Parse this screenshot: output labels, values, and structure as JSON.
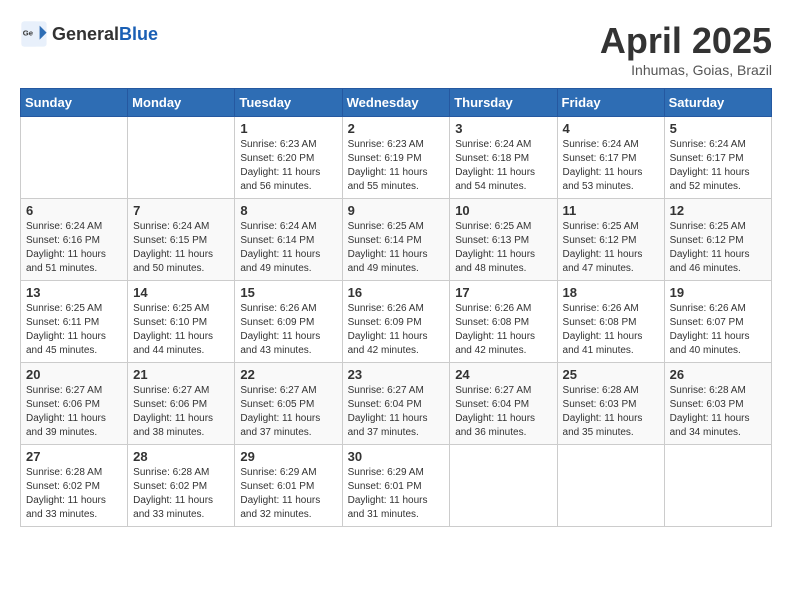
{
  "header": {
    "logo_general": "General",
    "logo_blue": "Blue",
    "title": "April 2025",
    "subtitle": "Inhumas, Goias, Brazil"
  },
  "calendar": {
    "days_of_week": [
      "Sunday",
      "Monday",
      "Tuesday",
      "Wednesday",
      "Thursday",
      "Friday",
      "Saturday"
    ],
    "weeks": [
      [
        {
          "day": "",
          "info": ""
        },
        {
          "day": "",
          "info": ""
        },
        {
          "day": "1",
          "info": "Sunrise: 6:23 AM\nSunset: 6:20 PM\nDaylight: 11 hours and 56 minutes."
        },
        {
          "day": "2",
          "info": "Sunrise: 6:23 AM\nSunset: 6:19 PM\nDaylight: 11 hours and 55 minutes."
        },
        {
          "day": "3",
          "info": "Sunrise: 6:24 AM\nSunset: 6:18 PM\nDaylight: 11 hours and 54 minutes."
        },
        {
          "day": "4",
          "info": "Sunrise: 6:24 AM\nSunset: 6:17 PM\nDaylight: 11 hours and 53 minutes."
        },
        {
          "day": "5",
          "info": "Sunrise: 6:24 AM\nSunset: 6:17 PM\nDaylight: 11 hours and 52 minutes."
        }
      ],
      [
        {
          "day": "6",
          "info": "Sunrise: 6:24 AM\nSunset: 6:16 PM\nDaylight: 11 hours and 51 minutes."
        },
        {
          "day": "7",
          "info": "Sunrise: 6:24 AM\nSunset: 6:15 PM\nDaylight: 11 hours and 50 minutes."
        },
        {
          "day": "8",
          "info": "Sunrise: 6:24 AM\nSunset: 6:14 PM\nDaylight: 11 hours and 49 minutes."
        },
        {
          "day": "9",
          "info": "Sunrise: 6:25 AM\nSunset: 6:14 PM\nDaylight: 11 hours and 49 minutes."
        },
        {
          "day": "10",
          "info": "Sunrise: 6:25 AM\nSunset: 6:13 PM\nDaylight: 11 hours and 48 minutes."
        },
        {
          "day": "11",
          "info": "Sunrise: 6:25 AM\nSunset: 6:12 PM\nDaylight: 11 hours and 47 minutes."
        },
        {
          "day": "12",
          "info": "Sunrise: 6:25 AM\nSunset: 6:12 PM\nDaylight: 11 hours and 46 minutes."
        }
      ],
      [
        {
          "day": "13",
          "info": "Sunrise: 6:25 AM\nSunset: 6:11 PM\nDaylight: 11 hours and 45 minutes."
        },
        {
          "day": "14",
          "info": "Sunrise: 6:25 AM\nSunset: 6:10 PM\nDaylight: 11 hours and 44 minutes."
        },
        {
          "day": "15",
          "info": "Sunrise: 6:26 AM\nSunset: 6:09 PM\nDaylight: 11 hours and 43 minutes."
        },
        {
          "day": "16",
          "info": "Sunrise: 6:26 AM\nSunset: 6:09 PM\nDaylight: 11 hours and 42 minutes."
        },
        {
          "day": "17",
          "info": "Sunrise: 6:26 AM\nSunset: 6:08 PM\nDaylight: 11 hours and 42 minutes."
        },
        {
          "day": "18",
          "info": "Sunrise: 6:26 AM\nSunset: 6:08 PM\nDaylight: 11 hours and 41 minutes."
        },
        {
          "day": "19",
          "info": "Sunrise: 6:26 AM\nSunset: 6:07 PM\nDaylight: 11 hours and 40 minutes."
        }
      ],
      [
        {
          "day": "20",
          "info": "Sunrise: 6:27 AM\nSunset: 6:06 PM\nDaylight: 11 hours and 39 minutes."
        },
        {
          "day": "21",
          "info": "Sunrise: 6:27 AM\nSunset: 6:06 PM\nDaylight: 11 hours and 38 minutes."
        },
        {
          "day": "22",
          "info": "Sunrise: 6:27 AM\nSunset: 6:05 PM\nDaylight: 11 hours and 37 minutes."
        },
        {
          "day": "23",
          "info": "Sunrise: 6:27 AM\nSunset: 6:04 PM\nDaylight: 11 hours and 37 minutes."
        },
        {
          "day": "24",
          "info": "Sunrise: 6:27 AM\nSunset: 6:04 PM\nDaylight: 11 hours and 36 minutes."
        },
        {
          "day": "25",
          "info": "Sunrise: 6:28 AM\nSunset: 6:03 PM\nDaylight: 11 hours and 35 minutes."
        },
        {
          "day": "26",
          "info": "Sunrise: 6:28 AM\nSunset: 6:03 PM\nDaylight: 11 hours and 34 minutes."
        }
      ],
      [
        {
          "day": "27",
          "info": "Sunrise: 6:28 AM\nSunset: 6:02 PM\nDaylight: 11 hours and 33 minutes."
        },
        {
          "day": "28",
          "info": "Sunrise: 6:28 AM\nSunset: 6:02 PM\nDaylight: 11 hours and 33 minutes."
        },
        {
          "day": "29",
          "info": "Sunrise: 6:29 AM\nSunset: 6:01 PM\nDaylight: 11 hours and 32 minutes."
        },
        {
          "day": "30",
          "info": "Sunrise: 6:29 AM\nSunset: 6:01 PM\nDaylight: 11 hours and 31 minutes."
        },
        {
          "day": "",
          "info": ""
        },
        {
          "day": "",
          "info": ""
        },
        {
          "day": "",
          "info": ""
        }
      ]
    ]
  }
}
